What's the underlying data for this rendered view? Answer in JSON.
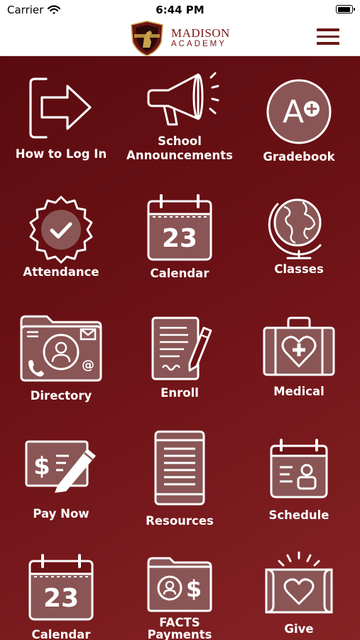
{
  "status_bar": {
    "carrier": "Carrier",
    "time": "6:44 PM"
  },
  "header": {
    "logo_line1": "MADISON",
    "logo_line2": "ACADEMY"
  },
  "tiles": [
    {
      "label": "How to Log In",
      "icon": "login-arrow-icon"
    },
    {
      "label": "School\nAnnouncements",
      "icon": "megaphone-icon"
    },
    {
      "label": "Gradebook",
      "icon": "grade-a-plus-icon"
    },
    {
      "label": "Attendance",
      "icon": "badge-check-icon"
    },
    {
      "label": "Calendar",
      "icon": "calendar-icon",
      "day": "23"
    },
    {
      "label": "Classes",
      "icon": "globe-icon"
    },
    {
      "label": "Directory",
      "icon": "directory-folder-icon"
    },
    {
      "label": "Enroll",
      "icon": "document-pen-icon"
    },
    {
      "label": "Medical",
      "icon": "medical-kit-icon"
    },
    {
      "label": "Pay Now",
      "icon": "check-pen-icon"
    },
    {
      "label": "Resources",
      "icon": "tablet-icon"
    },
    {
      "label": "Schedule",
      "icon": "schedule-calendar-icon"
    },
    {
      "label": "Calendar",
      "icon": "calendar-icon",
      "day": "23"
    },
    {
      "label": "FACTS\nPayments",
      "icon": "facts-folder-icon"
    },
    {
      "label": "Give",
      "icon": "give-heart-icon"
    }
  ],
  "colors": {
    "background": "#6d1216",
    "accent": "#7a1717",
    "icon": "#ffffff"
  }
}
